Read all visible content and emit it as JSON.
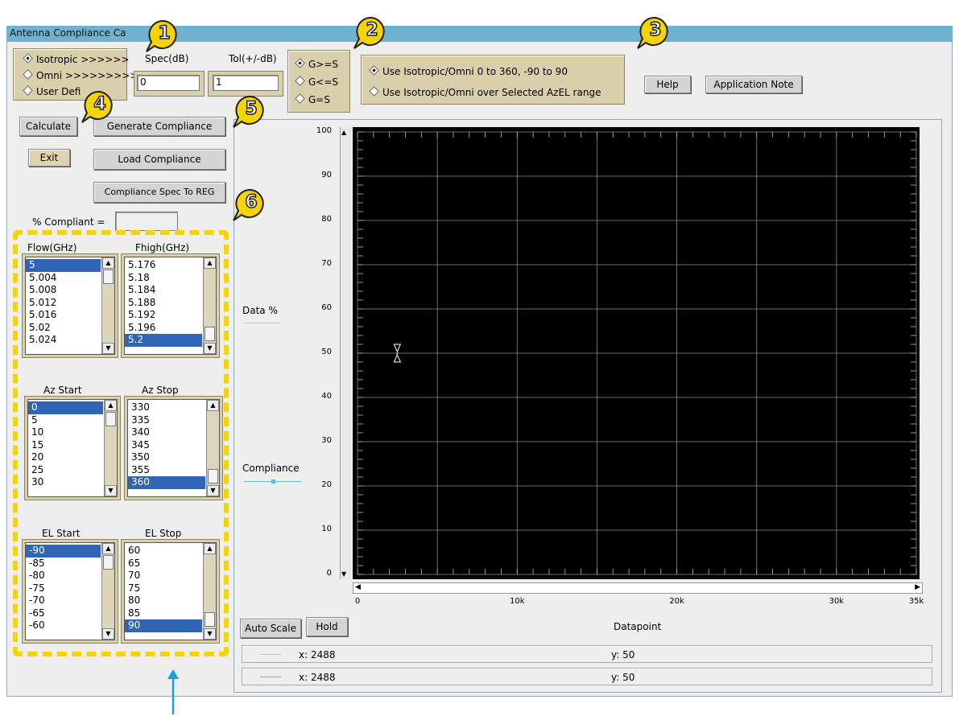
{
  "window": {
    "title": "Antenna Compliance Ca"
  },
  "gain_type": {
    "options": [
      {
        "label": "Isotropic >>>>>>",
        "selected": true
      },
      {
        "label": "Omni >>>>>>>>>",
        "selected": false
      },
      {
        "label": "User Defi",
        "selected": false
      }
    ]
  },
  "spec": {
    "label": "Spec(dB)",
    "value": "0"
  },
  "tol": {
    "label": "Tol(+/-dB)",
    "value": "1"
  },
  "comparison": {
    "options": [
      {
        "label": "G>=S",
        "selected": true
      },
      {
        "label": "G<=S",
        "selected": false
      },
      {
        "label": "G=S",
        "selected": false
      }
    ]
  },
  "range_mode": {
    "options": [
      {
        "label": "Use Isotropic/Omni 0 to 360, -90 to 90",
        "selected": true
      },
      {
        "label": "Use Isotropic/Omni over Selected AzEL range",
        "selected": false
      }
    ]
  },
  "buttons": {
    "help": "Help",
    "app_note": "Application Note",
    "calculate": "Calculate",
    "generate": "Generate Compliance",
    "exit": "Exit",
    "load": "Load Compliance",
    "spec_to_reg": "Compliance Spec To REG",
    "auto_scale": "Auto Scale",
    "hold": "Hold"
  },
  "compliant": {
    "label": "% Compliant =",
    "value": ""
  },
  "lists": {
    "flow": {
      "header": "Flow(GHz)",
      "items": [
        "5",
        "5.004",
        "5.008",
        "5.012",
        "5.016",
        "5.02",
        "5.024"
      ],
      "selected": 0
    },
    "fhigh": {
      "header": "Fhigh(GHz)",
      "items": [
        "5.176",
        "5.18",
        "5.184",
        "5.188",
        "5.192",
        "5.196",
        "5.2"
      ],
      "selected": 6
    },
    "az_start": {
      "header": "Az Start",
      "items": [
        "0",
        "5",
        "10",
        "15",
        "20",
        "25",
        "30"
      ],
      "selected": 0
    },
    "az_stop": {
      "header": "Az Stop",
      "items": [
        "330",
        "335",
        "340",
        "345",
        "350",
        "355",
        "360"
      ],
      "selected": 6
    },
    "el_start": {
      "header": "EL Start",
      "items": [
        "-90",
        "-85",
        "-80",
        "-75",
        "-70",
        "-65",
        "-60"
      ],
      "selected": 0
    },
    "el_stop": {
      "header": "EL Stop",
      "items": [
        "60",
        "65",
        "70",
        "75",
        "80",
        "85",
        "90"
      ],
      "selected": 6
    }
  },
  "legend": {
    "data": "Data %",
    "compliance": "Compliance"
  },
  "chart_data": {
    "type": "scatter",
    "xlabel": "Datapoint",
    "ylabel": "",
    "xlim": [
      0,
      35000
    ],
    "ylim": [
      0,
      100
    ],
    "x_ticks": [
      "0",
      "10k",
      "20k",
      "30k",
      "35k"
    ],
    "x_tick_values": [
      0,
      10000,
      20000,
      30000,
      35000
    ],
    "y_ticks": [
      "0",
      "10",
      "20",
      "30",
      "40",
      "50",
      "60",
      "70",
      "80",
      "90",
      "100"
    ],
    "y_tick_values": [
      0,
      10,
      20,
      30,
      40,
      50,
      60,
      70,
      80,
      90,
      100
    ],
    "grid": true,
    "series": [
      {
        "name": "Data %",
        "x": [
          2488
        ],
        "y": [
          50
        ],
        "color": "#f0d000"
      },
      {
        "name": "Compliance",
        "x": [],
        "y": [],
        "color": "#60b8e8"
      }
    ]
  },
  "readouts": [
    {
      "x": "x: 2488",
      "y": "y: 50"
    },
    {
      "x": "x: 2488",
      "y": "y: 50"
    }
  ],
  "callouts": [
    "1",
    "2",
    "3",
    "4",
    "5",
    "6"
  ],
  "colors": {
    "accent": "#f5d400",
    "plot_bg": "#000000",
    "selection": "#3064b4",
    "titlebar": "#6fb2cf",
    "arrow": "#1a9ee0"
  }
}
